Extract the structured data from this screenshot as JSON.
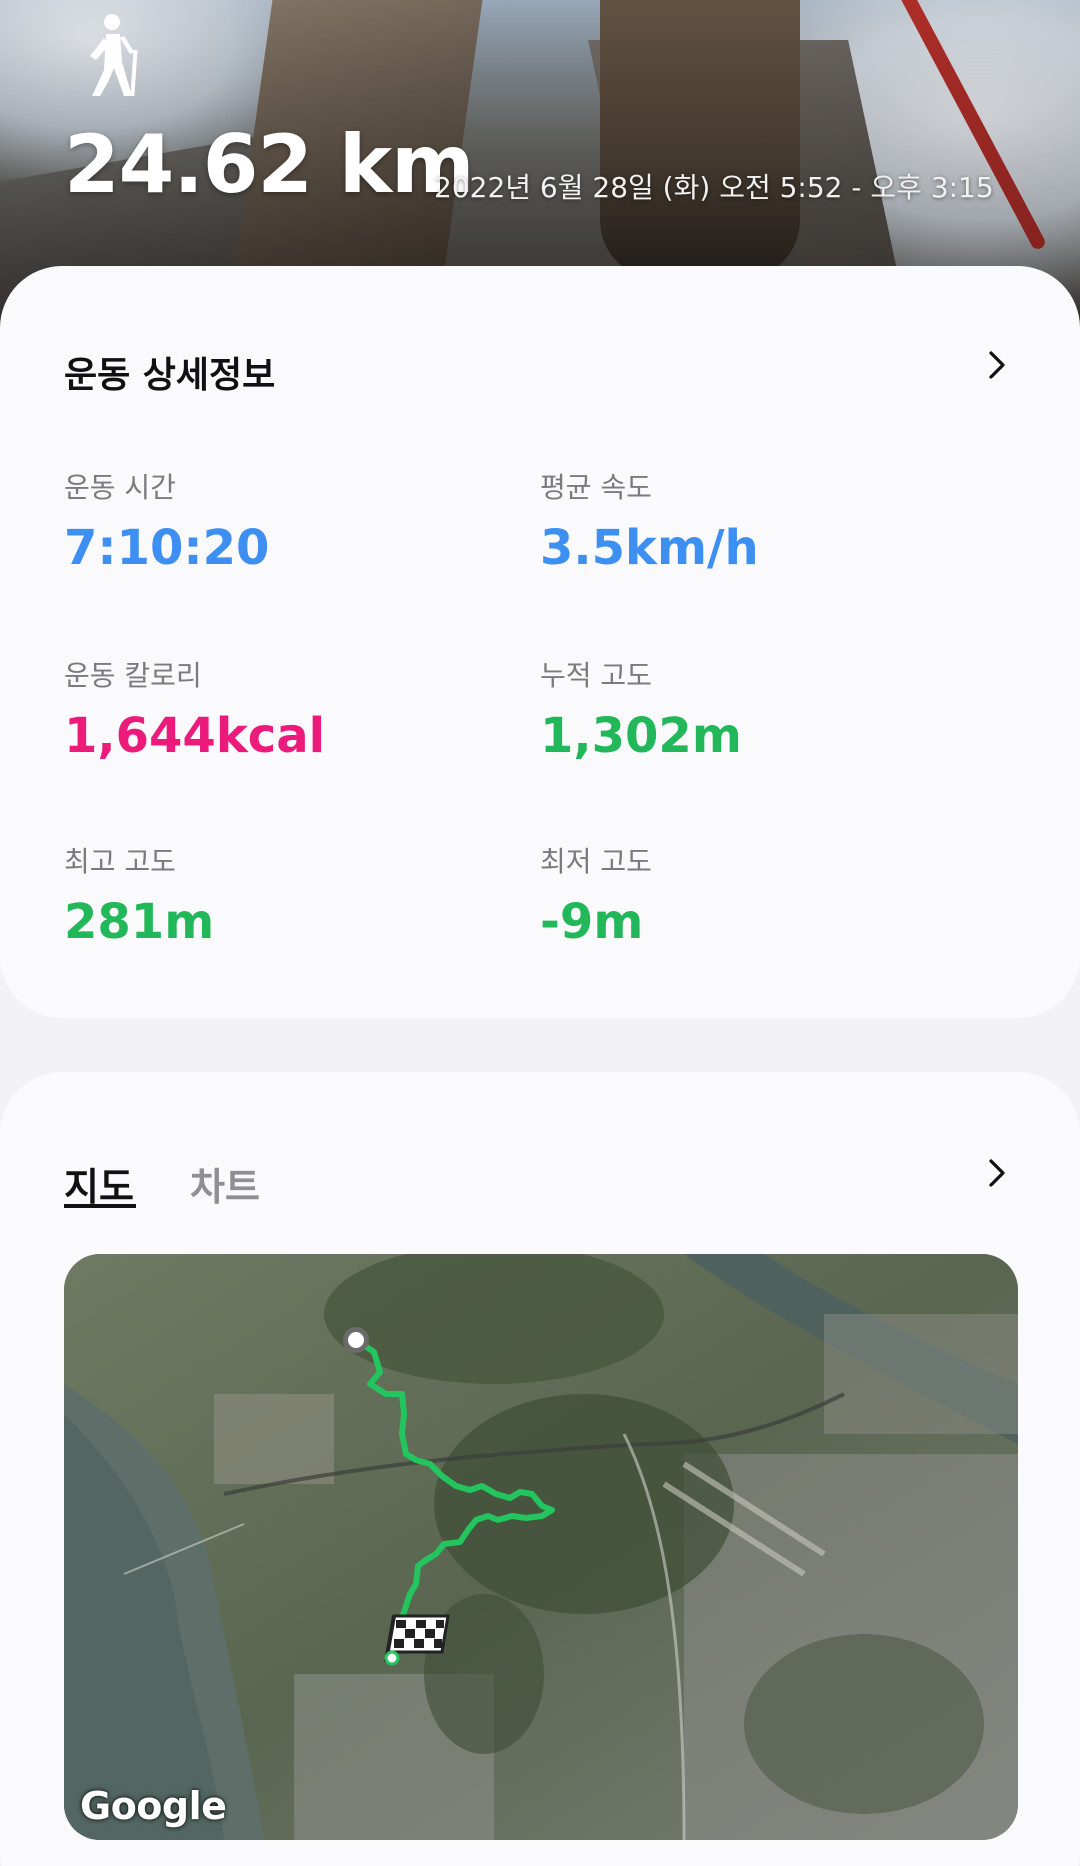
{
  "hero": {
    "activity_icon": "hiking-person-icon",
    "distance": "24.62 km",
    "session_datetime": "2022년 6월 28일 (화) 오전 5:52 - 오후 3:15"
  },
  "details": {
    "title": "운동 상세정보",
    "more_icon": "chevron-right-icon",
    "stats": [
      {
        "label": "운동 시간",
        "value": "7:10:20",
        "color": "#3d8ff2"
      },
      {
        "label": "평균 속도",
        "value": "3.5km/h",
        "color": "#3d8ff2"
      },
      {
        "label": "운동 칼로리",
        "value": "1,644kcal",
        "color": "#ec1a7a"
      },
      {
        "label": "누적 고도",
        "value": "1,302m",
        "color": "#22b85a"
      },
      {
        "label": "최고 고도",
        "value": "281m",
        "color": "#22b85a"
      },
      {
        "label": "최저 고도",
        "value": "-9m",
        "color": "#22b85a"
      }
    ]
  },
  "map_section": {
    "tabs": [
      {
        "label": "지도",
        "active": true
      },
      {
        "label": "차트",
        "active": false
      }
    ],
    "more_icon": "chevron-right-icon",
    "map_provider_logo": "Google",
    "route_color": "#22c55e",
    "start_marker_icon": "start-dot-icon",
    "finish_marker_icon": "checkered-flag-icon"
  }
}
